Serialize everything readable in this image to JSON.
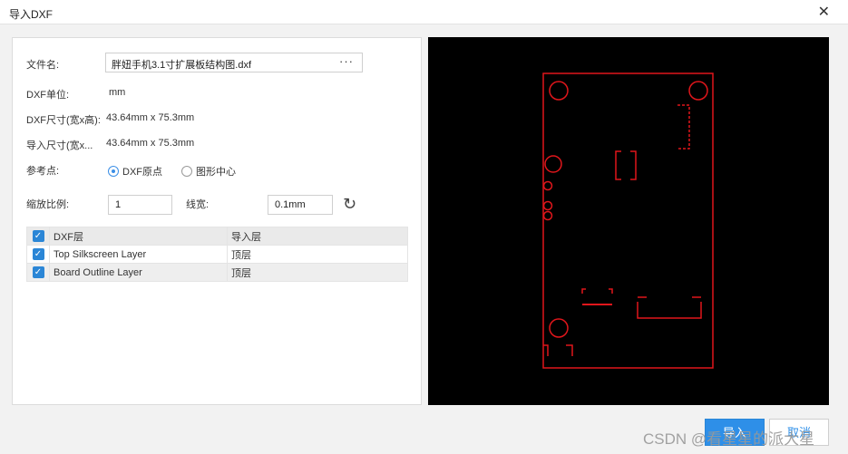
{
  "window": {
    "title": "导入DXF",
    "close_glyph": "✕"
  },
  "form": {
    "file_label": "文件名:",
    "file_value": "胖妞手机3.1寸扩展板结构图.dxf",
    "browse_glyph": "···",
    "unit_label": "DXF单位:",
    "unit_value": "mm",
    "dxf_size_label": "DXF尺寸(宽x高):",
    "dxf_size_value": "43.64mm x 75.3mm",
    "import_size_label": "导入尺寸(宽x...",
    "import_size_value": "43.64mm x 75.3mm",
    "ref_point_label": "参考点:",
    "ref_options": [
      {
        "label": "DXF原点",
        "checked": true
      },
      {
        "label": "图形中心",
        "checked": false
      }
    ],
    "scale_label": "缩放比例:",
    "scale_value": "1",
    "line_width_label": "线宽:",
    "line_width_value": "0.1mm",
    "refresh_glyph": "↻"
  },
  "layers_table": {
    "headers": [
      "DXF层",
      "导入层"
    ],
    "rows": [
      {
        "dxf_layer": "Top Silkscreen Layer",
        "import_layer": "顶层",
        "checked": true
      },
      {
        "dxf_layer": "Board Outline Layer",
        "import_layer": "顶层",
        "checked": true
      }
    ]
  },
  "preview": {
    "background": "#000000",
    "stroke_color": "#e0161b"
  },
  "buttons": {
    "ok_label": "导入",
    "cancel_label": "取消"
  },
  "watermark": "CSDN @看星星的派大星",
  "colors": {
    "accent": "#2e8fe8",
    "checkbox": "#2b86d6"
  }
}
